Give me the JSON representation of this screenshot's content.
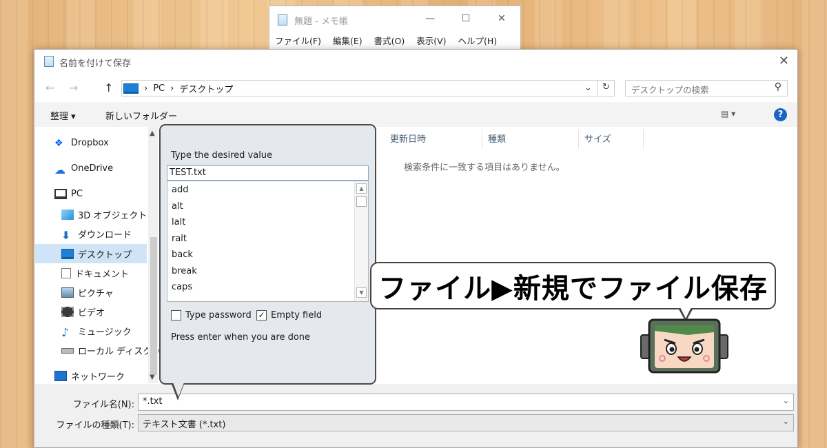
{
  "notepad": {
    "title": "無題 - メモ帳",
    "menu": [
      "ファイル(F)",
      "編集(E)",
      "書式(O)",
      "表示(V)",
      "ヘルプ(H)"
    ],
    "min": "—",
    "max": "☐",
    "close": "✕"
  },
  "dialog": {
    "title": "名前を付けて保存",
    "close": "✕",
    "nav": {
      "back": "←",
      "forward": "→",
      "up": "↑"
    },
    "address": {
      "pc": "PC",
      "sep": "›",
      "folder": "デスクトップ"
    },
    "search_placeholder": "デスクトップの検索",
    "toolbar": {
      "organize": "整理 ▾",
      "new_folder": "新しいフォルダー",
      "view": "▤ ▾",
      "help": "?"
    },
    "sidebar": {
      "items": [
        "Dropbox",
        "OneDrive",
        "PC",
        "3D オブジェクト",
        "ダウンロード",
        "デスクトップ",
        "ドキュメント",
        "ピクチャ",
        "ビデオ",
        "ミュージック",
        "ローカル ディスク (C",
        "ネットワーク"
      ]
    },
    "columns": [
      "更新日時",
      "種類",
      "サイズ"
    ],
    "empty_message": "検索条件に一致する項目はありません。",
    "filename_label": "ファイル名(N):",
    "filename_value": "*.txt",
    "filetype_label": "ファイルの種類(T):",
    "filetype_value": "テキスト文書 (*.txt)"
  },
  "popup": {
    "title": "Type the desired value",
    "input_value": "TEST.txt",
    "list": [
      "add",
      "alt",
      "lalt",
      "ralt",
      "back",
      "break",
      "caps"
    ],
    "checkbox_password": {
      "label": "Type password",
      "checked": false
    },
    "checkbox_empty": {
      "label": "Empty field",
      "checked": true
    },
    "footer": "Press enter when you are done"
  },
  "callout": "ファイル▶新規でファイル保存",
  "colors": {
    "selection": "#cfe5f7",
    "popup_bg": "#e5e9ee",
    "help_blue": "#1a65c2"
  }
}
